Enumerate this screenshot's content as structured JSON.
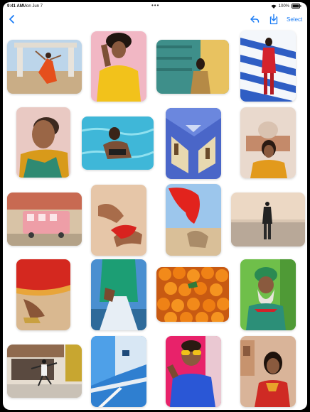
{
  "status_bar": {
    "time": "9:41 AM",
    "date": "Mon Jun 7",
    "battery": "100%",
    "dots": "•••"
  },
  "toolbar": {
    "back_icon": "chevron-left-icon",
    "reply_icon": "reply-icon",
    "download_icon": "download-icon",
    "select_label": "Select"
  },
  "accent_color": "#1a7cf5",
  "photos": [
    {
      "name": "photo-dancer-red-dress"
    },
    {
      "name": "photo-woman-yellow-shirt"
    },
    {
      "name": "photo-woman-teal-wall"
    },
    {
      "name": "photo-woman-striped-backdrop"
    },
    {
      "name": "photo-older-woman-portrait"
    },
    {
      "name": "photo-swimmer-pool"
    },
    {
      "name": "photo-blue-building"
    },
    {
      "name": "photo-woman-humayun-tomb"
    },
    {
      "name": "photo-pink-train-car"
    },
    {
      "name": "photo-hands-red-fabric"
    },
    {
      "name": "photo-red-fabric-sky"
    },
    {
      "name": "photo-man-beach-sunset"
    },
    {
      "name": "photo-feet-red-sari"
    },
    {
      "name": "photo-green-shirt-figure"
    },
    {
      "name": "photo-oranges"
    },
    {
      "name": "photo-man-green-turban"
    },
    {
      "name": "photo-dancer-street"
    },
    {
      "name": "photo-blue-wall-stairs"
    },
    {
      "name": "photo-man-sunglasses"
    },
    {
      "name": "photo-woman-red-sari"
    }
  ]
}
